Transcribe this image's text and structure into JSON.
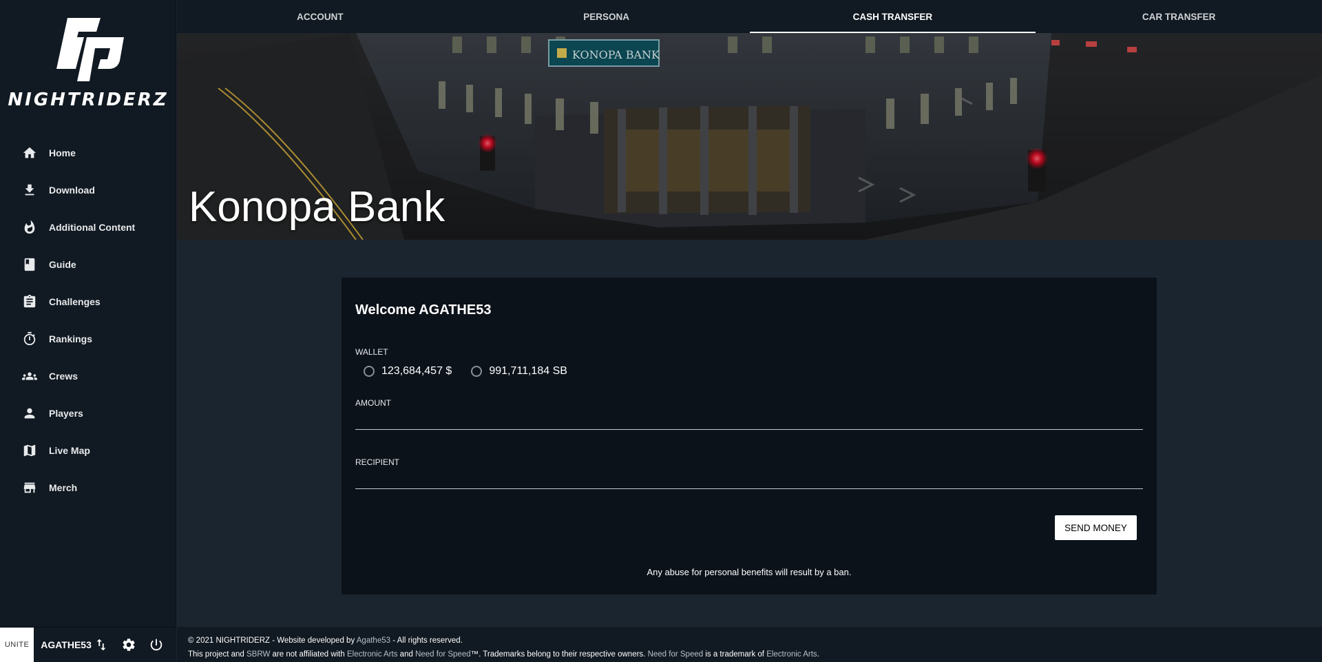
{
  "brand": {
    "name": "NIGHTRIDERZ"
  },
  "nav": {
    "items": [
      {
        "label": "Home",
        "icon": "home-icon"
      },
      {
        "label": "Download",
        "icon": "download-icon"
      },
      {
        "label": "Additional Content",
        "icon": "fire-icon"
      },
      {
        "label": "Guide",
        "icon": "book-icon"
      },
      {
        "label": "Challenges",
        "icon": "clipboard-icon"
      },
      {
        "label": "Rankings",
        "icon": "stopwatch-icon"
      },
      {
        "label": "Crews",
        "icon": "group-icon"
      },
      {
        "label": "Players",
        "icon": "person-icon"
      },
      {
        "label": "Live Map",
        "icon": "map-icon"
      },
      {
        "label": "Merch",
        "icon": "store-icon"
      }
    ]
  },
  "userbar": {
    "unite": "UNITE",
    "username": "AGATHE53"
  },
  "tabs": [
    {
      "label": "ACCOUNT",
      "active": false
    },
    {
      "label": "PERSONA",
      "active": false
    },
    {
      "label": "CASH TRANSFER",
      "active": true
    },
    {
      "label": "CAR TRANSFER",
      "active": false
    }
  ],
  "hero": {
    "title": "Konopa Bank",
    "sign": "KONOPA BANK"
  },
  "form": {
    "welcome": "Welcome AGATHE53",
    "wallet_label": "WALLET",
    "wallet_options": [
      "123,684,457 $",
      "991,711,184 SB"
    ],
    "amount_label": "AMOUNT",
    "amount_value": "",
    "recipient_label": "RECIPIENT",
    "recipient_value": "",
    "send_label": "SEND MONEY",
    "warning": "Any abuse for personal benefits will result by a ban."
  },
  "footer": {
    "line1_pre": "© 2021 NIGHTRIDERZ - Website developed by ",
    "line1_link": "Agathe53",
    "line1_post": " - All rights reserved.",
    "line2_a": "This project and ",
    "line2_sbrw": "SBRW",
    "line2_b": " are not affiliated with ",
    "line2_ea": "Electronic Arts",
    "line2_c": " and ",
    "line2_nfs": "Need for Speed",
    "line2_d": "™. Trademarks belong to their respective owners. ",
    "line2_nfs2": "Need for Speed",
    "line2_e": " is a trademark of ",
    "line2_ea2": "Electronic Arts",
    "line2_f": "."
  },
  "colors": {
    "sidebar_bg": "#111922",
    "page_bg": "#1b2530",
    "card_bg": "#0c121a"
  }
}
